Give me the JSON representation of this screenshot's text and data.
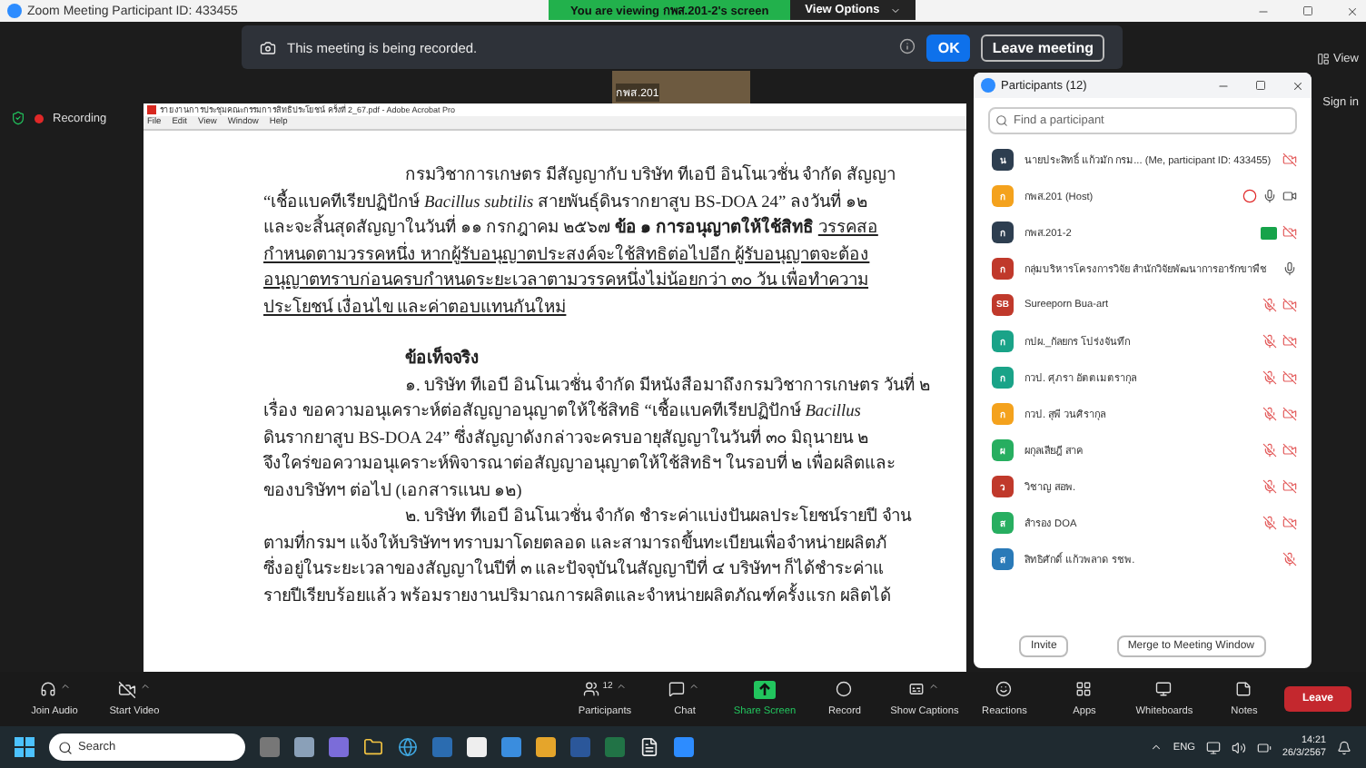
{
  "window": {
    "title": "Zoom Meeting Participant ID: 433455"
  },
  "share_banner": {
    "text": "You are viewing กพส.201-2's screen",
    "button": "View Options"
  },
  "notice": {
    "text": "This meeting is being recorded.",
    "ok": "OK",
    "leave": "Leave meeting"
  },
  "thumbnail": {
    "label": "กพส.201"
  },
  "recording": {
    "label": "Recording"
  },
  "sign_in": "Sign in",
  "view_button": "View",
  "document": {
    "title": "รายงานการประชุมคณะกรรมการสิทธิประโยชน์ ครั้งที่ 2_67.pdf - Adobe Acrobat Pro",
    "menu": [
      "File",
      "Edit",
      "View",
      "Window",
      "Help"
    ],
    "lines": [
      {
        "kind": "indent",
        "text": "กรมวิชาการเกษตร มีสัญญากับ บริษัท ทีเอบี อินโนเวชั่น จำกัด สัญญา"
      },
      {
        "kind": "plain",
        "text": "“เชื้อแบคทีเรียปฏิปักษ์ *Bacillus subtilis* สายพันธุ์ดินรากยาสูบ BS-DOA 24” ลงวันที่ ๑๒"
      },
      {
        "kind": "plain",
        "text": "และจะสิ้นสุดสัญญาในวันที่ ๑๑ กรกฎาคม ๒๕๖๗ **ข้อ ๑ การอนุญาตให้ใช้สิทธิ**",
        "underlined_tail": "วรรคสอ"
      },
      {
        "kind": "underlined",
        "text": "กำหนดตามวรรคหนึ่ง หากผู้รับอนุญาตประสงค์จะใช้สิทธิต่อไปอีก ผู้รับอนุญาตจะต้อง"
      },
      {
        "kind": "underlined",
        "text": "อนุญาตทราบก่อนครบกำหนดระยะเวลาตามวรรคหนึ่งไม่น้อยกว่า ๓๐ วัน เพื่อทำความ"
      },
      {
        "kind": "underlined",
        "text": "ประโยชน์ เงื่อนไข และค่าตอบแทนกันใหม่"
      },
      {
        "kind": "heading",
        "text": "ข้อเท็จจริง"
      },
      {
        "kind": "indent",
        "text": "๑. บริษัท ทีเอบี อินโนเวชั่น จำกัด มีหนังสือมาถึงกรมวิชาการเกษตร วันที่ ๒"
      },
      {
        "kind": "plain",
        "text": "เรื่อง ขอความอนุเคราะห์ต่อสัญญาอนุญาตให้ใช้สิทธิ “เชื้อแบคทีเรียปฏิปักษ์ *Bacillus*"
      },
      {
        "kind": "plain",
        "text": "ดินรากยาสูบ BS-DOA 24” ซึ่งสัญญาดังกล่าวจะครบอายุสัญญาในวันที่ ๓๐ มิถุนายน ๒"
      },
      {
        "kind": "plain",
        "text": "จึงใคร่ขอความอนุเคราะห์พิจารณาต่อสัญญาอนุญาตให้ใช้สิทธิฯ ในรอบที่ ๒ เพื่อผลิตและ"
      },
      {
        "kind": "plain",
        "text": "ของบริษัทฯ ต่อไป (เอกสารแนบ ๑๒)"
      },
      {
        "kind": "indent",
        "text": "๒. บริษัท ทีเอบี อินโนเวชั่น จำกัด ชำระค่าแบ่งปันผลประโยชน์รายปี จำน"
      },
      {
        "kind": "plain",
        "text": "ตามที่กรมฯ แจ้งให้บริษัทฯ ทราบมาโดยตลอด และสามารถขึ้นทะเบียนเพื่อจำหน่ายผลิตภั"
      },
      {
        "kind": "plain",
        "text": "ซึ่งอยู่ในระยะเวลาของสัญญาในปีที่ ๓ และปัจจุบันในสัญญาปีที่ ๔ บริษัทฯ ก็ได้ชำระค่าแ"
      },
      {
        "kind": "plain",
        "text": "รายปีเรียบร้อยแล้ว พร้อมรายงานปริมาณการผลิตและจำหน่ายผลิตภัณฑ์ครั้งแรก ผลิตได้"
      }
    ]
  },
  "participants_panel": {
    "title": "Participants (12)",
    "search": {
      "placeholder": "Find a participant"
    },
    "participants": [
      {
        "initial": "น",
        "color": "#2d3e50",
        "name": "นายประสิทธิ์ แก้วมัก กรม... (Me, participant ID: 433455)",
        "status_icons": [
          {
            "kind": "video_off"
          }
        ]
      },
      {
        "initial": "ก",
        "color": "#f4a21d",
        "name": "กพส.201 (Host)",
        "status_icons": [
          {
            "kind": "recording"
          },
          {
            "kind": "mic_on"
          },
          {
            "kind": "video_on"
          }
        ]
      },
      {
        "initial": "ก",
        "color": "#2d3e50",
        "name": "กพส.201-2",
        "status_icons": [
          {
            "kind": "sharing"
          },
          {
            "kind": "video_off"
          }
        ]
      },
      {
        "initial": "ก",
        "color": "#c0392b",
        "name": "กลุ่มบริหารโครงการวิจัย สำนักวิจัยพัฒนาการอารักขาพืช",
        "status_icons": [
          {
            "kind": "mic_on"
          }
        ]
      },
      {
        "initial": "SB",
        "color": "#c0392b",
        "name": "Sureeporn Bua-art",
        "status_icons": [
          {
            "kind": "mic_muted"
          },
          {
            "kind": "video_off"
          }
        ]
      },
      {
        "initial": "ก",
        "color": "#1aa388",
        "name": "กปผ._กัลยกร โปร่งจันทึก",
        "status_icons": [
          {
            "kind": "mic_muted"
          },
          {
            "kind": "video_off"
          }
        ]
      },
      {
        "initial": "ก",
        "color": "#1aa388",
        "name": "กวป. ศุภรา อัตตเมตรากุล",
        "status_icons": [
          {
            "kind": "mic_muted"
          },
          {
            "kind": "video_off"
          }
        ]
      },
      {
        "initial": "ก",
        "color": "#f4a21d",
        "name": "กวป. สุพี วนศิรากุล",
        "status_icons": [
          {
            "kind": "mic_muted"
          },
          {
            "kind": "video_off"
          }
        ]
      },
      {
        "initial": "ผ",
        "color": "#27ae60",
        "name": "ผกุลเสียฎี สาค",
        "status_icons": [
          {
            "kind": "mic_muted"
          },
          {
            "kind": "video_off"
          }
        ]
      },
      {
        "initial": "ว",
        "color": "#c0392b",
        "name": "วิชาญ สอพ.",
        "status_icons": [
          {
            "kind": "mic_muted"
          },
          {
            "kind": "video_off"
          }
        ]
      },
      {
        "initial": "ส",
        "color": "#27ae60",
        "name": "สำรอง DOA",
        "status_icons": [
          {
            "kind": "mic_muted"
          },
          {
            "kind": "video_off"
          }
        ]
      },
      {
        "initial": "ส",
        "color": "#2a7ab8",
        "name": "สิทธิศักดิ์ แก้วพลาด รชพ.",
        "status_icons": [
          {
            "kind": "mic_muted"
          }
        ]
      }
    ],
    "buttons": [
      "Invite",
      "Merge to Meeting Window"
    ]
  },
  "toolbar": {
    "items": [
      {
        "kind": "audio",
        "label": "Join Audio",
        "caret": true
      },
      {
        "kind": "video",
        "label": "Start Video",
        "caret": true
      },
      {
        "kind": "participants",
        "label": "Participants",
        "count": "12",
        "caret": true
      },
      {
        "kind": "chat",
        "label": "Chat",
        "caret": true
      },
      {
        "kind": "share",
        "label": "Share Screen",
        "caret": false
      },
      {
        "kind": "record",
        "label": "Record",
        "caret": false
      },
      {
        "kind": "captions",
        "label": "Show Captions",
        "caret": true
      },
      {
        "kind": "reactions",
        "label": "Reactions",
        "caret": false
      },
      {
        "kind": "apps",
        "label": "Apps",
        "caret": false
      },
      {
        "kind": "whiteboards",
        "label": "Whiteboards",
        "caret": false
      },
      {
        "kind": "notes",
        "label": "Notes",
        "caret": false
      }
    ],
    "leave": "Leave"
  },
  "taskbar": {
    "search": {
      "placeholder": "Search"
    },
    "language": "ENG",
    "time": "14:21",
    "date": "26/3/2567"
  }
}
